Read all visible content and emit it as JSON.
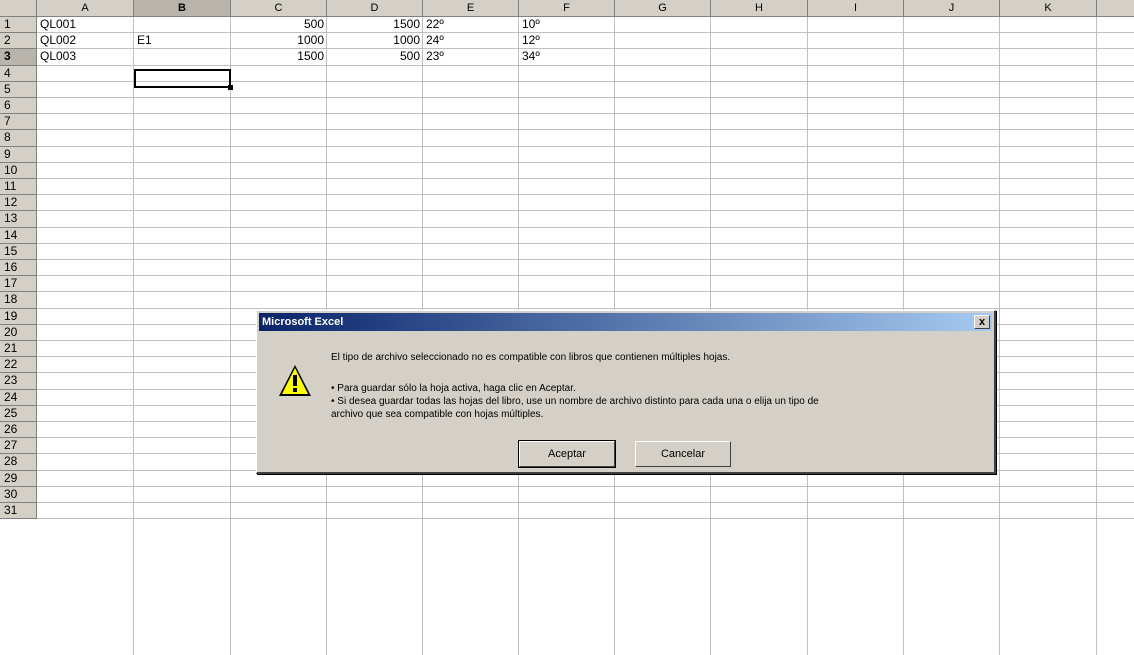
{
  "columns": [
    "A",
    "B",
    "C",
    "D",
    "E",
    "F",
    "G",
    "H",
    "I",
    "J",
    "K"
  ],
  "active_column": "B",
  "active_row": "3",
  "row_numbers": [
    "1",
    "2",
    "3",
    "4",
    "5",
    "6",
    "7",
    "8",
    "9",
    "10",
    "11",
    "12",
    "13",
    "14",
    "15",
    "16",
    "17",
    "18",
    "19",
    "20",
    "21",
    "22",
    "23",
    "24",
    "25",
    "26",
    "27",
    "28",
    "29",
    "30",
    "31"
  ],
  "cells": {
    "A1": "QL001",
    "C1": "500",
    "D1": "1500",
    "E1": "22º",
    "F1": "10º",
    "A2": "QL002",
    "B2": "E1",
    "C2": "1000",
    "D2": "1000",
    "E2": "24º",
    "F2": "12º",
    "A3": "QL003",
    "C3": "1500",
    "D3": "500",
    "E3": "23º",
    "F3": "34º"
  },
  "dialog": {
    "title": "Microsoft Excel",
    "close_label": "x",
    "icon": "warning-icon",
    "message_line1": "El tipo de archivo seleccionado no es compatible con libros que contienen múltiples hojas.",
    "message_line2": "• Para guardar sólo la hoja activa, haga clic en Aceptar.",
    "message_line3": "• Si desea guardar todas las hojas del libro, use un nombre de archivo distinto para cada una o elija un tipo de",
    "message_line4": "archivo que sea compatible con hojas múltiples.",
    "ok_label": "Aceptar",
    "cancel_label": "Cancelar"
  },
  "colors": {
    "titlebar_start": "#0a246a",
    "titlebar_end": "#a6caf0",
    "chrome": "#d4d0c8",
    "gridline": "#c0c0c0"
  }
}
